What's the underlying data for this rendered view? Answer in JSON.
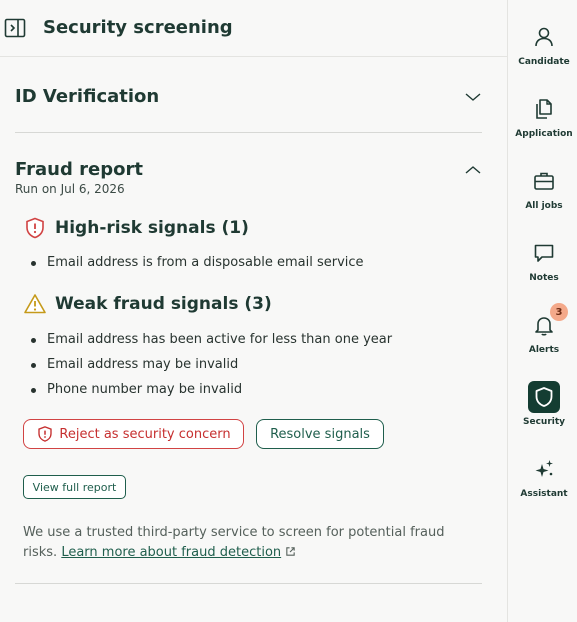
{
  "header": {
    "title": "Security screening"
  },
  "id_verification": {
    "title": "ID Verification"
  },
  "fraud_report": {
    "title": "Fraud report",
    "run_date": "Run on Jul 6, 2026",
    "high_risk": {
      "title": "High-risk signals (1)",
      "items": [
        "Email address is from a disposable email service"
      ]
    },
    "weak": {
      "title": "Weak fraud signals (3)",
      "items": [
        "Email address has been active for less than one year",
        "Email address may be invalid",
        "Phone number may be invalid"
      ]
    },
    "reject_label": "Reject as security concern",
    "resolve_label": "Resolve signals",
    "view_label": "View full report",
    "info_text": "We use a trusted third-party service to screen for potential fraud risks.",
    "info_link": "Learn more about fraud detection"
  },
  "rail": {
    "items": [
      {
        "label": "Candidate",
        "icon": "person-icon"
      },
      {
        "label": "Application",
        "icon": "documents-icon"
      },
      {
        "label": "All jobs",
        "icon": "briefcase-icon"
      },
      {
        "label": "Notes",
        "icon": "speech-bubble-icon"
      },
      {
        "label": "Alerts",
        "icon": "bell-icon",
        "badge": "3"
      },
      {
        "label": "Security",
        "icon": "shield-icon",
        "active": true
      },
      {
        "label": "Assistant",
        "icon": "sparkles-icon"
      }
    ]
  },
  "colors": {
    "accent": "#1f5e4c",
    "danger": "#d14343",
    "warning": "#c59a1a",
    "badge": "#f4a98a",
    "active_rail": "#143d32"
  }
}
